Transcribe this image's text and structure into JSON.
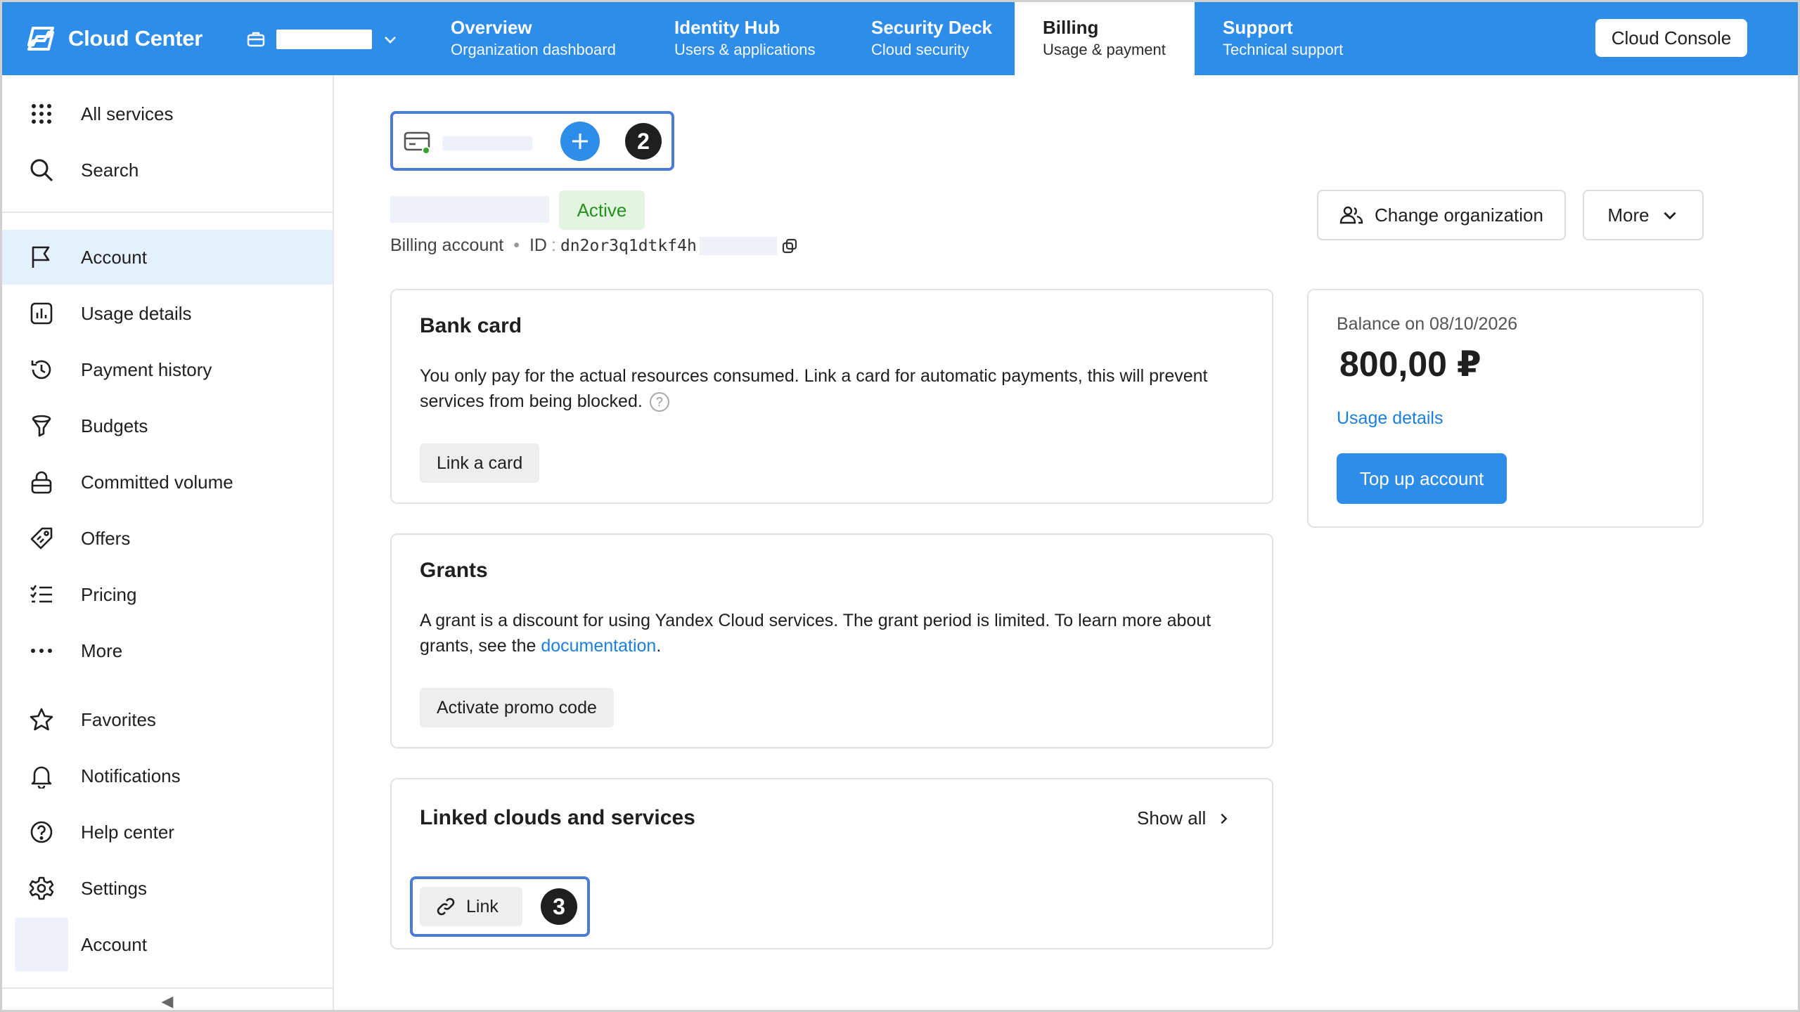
{
  "header": {
    "brand": "Cloud Center",
    "tabs": [
      {
        "title": "Overview",
        "subtitle": "Organization dashboard"
      },
      {
        "title": "Identity Hub",
        "subtitle": "Users & applications"
      },
      {
        "title": "Security Deck",
        "subtitle": "Cloud security"
      },
      {
        "title": "Billing",
        "subtitle": "Usage & payment"
      },
      {
        "title": "Support",
        "subtitle": "Technical support"
      }
    ],
    "active_tab": "Billing",
    "console_button": "Cloud Console",
    "brand_color": "#2f8dea"
  },
  "sidebar": {
    "top_items": [
      {
        "label": "All services",
        "icon": "grid-icon"
      },
      {
        "label": "Search",
        "icon": "search-icon"
      }
    ],
    "items": [
      {
        "label": "Account",
        "icon": "flag-icon",
        "selected": true
      },
      {
        "label": "Usage details",
        "icon": "chart-icon"
      },
      {
        "label": "Payment history",
        "icon": "history-icon"
      },
      {
        "label": "Budgets",
        "icon": "funnel-icon"
      },
      {
        "label": "Committed volume",
        "icon": "lock-icon"
      },
      {
        "label": "Offers",
        "icon": "tag-icon"
      },
      {
        "label": "Pricing",
        "icon": "list-check-icon"
      },
      {
        "label": "More",
        "icon": "ellipsis-icon"
      }
    ],
    "bottom_items": [
      {
        "label": "Favorites",
        "icon": "star-icon"
      },
      {
        "label": "Notifications",
        "icon": "bell-icon"
      },
      {
        "label": "Help center",
        "icon": "help-icon"
      },
      {
        "label": "Settings",
        "icon": "gear-icon"
      },
      {
        "label": "Account",
        "icon": "avatar"
      }
    ],
    "collapse_glyph": "◀"
  },
  "account_switcher": {
    "step_badge": "2"
  },
  "account": {
    "status": "Active",
    "meta_label": "Billing account",
    "id_label": "ID",
    "id_value": "dn2or3q1dtkf4h"
  },
  "actions": {
    "change_org": "Change organization",
    "more": "More"
  },
  "bank_card": {
    "title": "Bank card",
    "text": "You only pay for the actual resources consumed. Link a card for automatic payments, this will prevent services from being blocked.",
    "help": "?",
    "button": "Link a card"
  },
  "grants": {
    "title": "Grants",
    "text_before": "A grant is a discount for using Yandex Cloud services. The grant period is limited. To learn more about grants, see the ",
    "link": "documentation",
    "text_after": ".",
    "button": "Activate promo code"
  },
  "linked": {
    "title": "Linked clouds and services",
    "show_all": "Show all",
    "button": "Link",
    "step_badge": "3"
  },
  "balance": {
    "label": "Balance on 08/10/2026",
    "amount": "800,00 ₽",
    "usage_link": "Usage details",
    "top_up": "Top up account"
  }
}
